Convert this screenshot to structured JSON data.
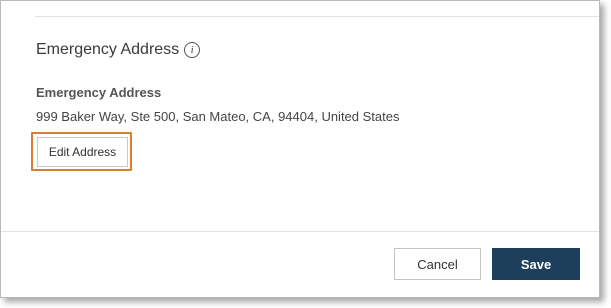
{
  "section": {
    "title": "Emergency Address",
    "info_icon_glyph": "i"
  },
  "address": {
    "label": "Emergency Address",
    "value": "999 Baker Way, Ste 500, San Mateo, CA, 94404, United States"
  },
  "actions": {
    "edit_label": "Edit Address",
    "cancel_label": "Cancel",
    "save_label": "Save"
  },
  "colors": {
    "highlight": "#d9802b",
    "primary_button": "#1d3f5c"
  },
  "icons": {
    "info": "info-icon"
  }
}
